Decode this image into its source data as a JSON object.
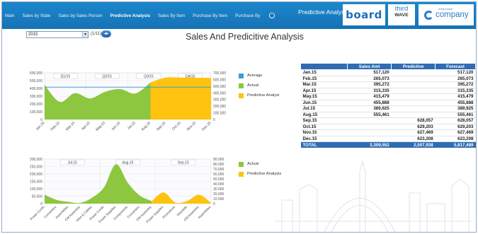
{
  "nav": {
    "items": [
      {
        "label": "Main",
        "active": false
      },
      {
        "label": "Sales by State",
        "active": false
      },
      {
        "label": "Sales by Sales Person",
        "active": false
      },
      {
        "label": "Predictive Analysis",
        "active": true
      },
      {
        "label": "Sales By Item",
        "active": false
      },
      {
        "label": "Purchase By Item",
        "active": false
      },
      {
        "label": "Purchase By",
        "active": false
      }
    ],
    "more_icon": "ⓘ"
  },
  "brand": {
    "section_title": "Predictive Analysis",
    "board_logo": "board",
    "third_wave_line1": "third",
    "third_wave_line2": "WAVE",
    "company_logo": "company",
    "company_prefix": "a third wave"
  },
  "controls": {
    "year": "2015",
    "pager": "(1/11)"
  },
  "page_title": "Sales And Predicitive Analysis",
  "colors": {
    "accent": "#1c87cc",
    "actual": "#8dc63f",
    "predictive": "#ffc20e",
    "average": "#3e9cdc",
    "table_header": "#2f6cb3"
  },
  "chart_data": [
    {
      "type": "area",
      "categories": [
        "Jan.15",
        "Feb.15",
        "Mar.15",
        "Apr.15",
        "May.15",
        "Jun.15",
        "Jul.15",
        "Aug.15",
        "Sep.15",
        "Oct.15",
        "Nov.15",
        "Dec.15"
      ],
      "series": [
        {
          "name": "Average",
          "values": [
            484796,
            484796,
            484796,
            484796,
            484796,
            484796,
            484796,
            484796,
            484796,
            484796,
            484796,
            484796
          ]
        },
        {
          "name": "Actual",
          "values": [
            517120,
            265073,
            395272,
            315335,
            415479,
            455888,
            389925,
            555461,
            null,
            null,
            null,
            null
          ]
        },
        {
          "name": "Predictive Analysi",
          "values": [
            null,
            null,
            null,
            null,
            null,
            null,
            null,
            555461,
            628057,
            629203,
            627469,
            623208
          ]
        }
      ],
      "quarter_labels": [
        "Q1/15",
        "Q2/15",
        "Q3/15",
        "Q4/15"
      ],
      "left_ticks": [
        "600,000",
        "500,000",
        "400,000",
        "300,000",
        "200,000",
        "100,000",
        "0"
      ],
      "right_ticks": [
        "700,000",
        "600,000",
        "500,000",
        "400,000",
        "300,000",
        "200,000",
        "100,000",
        "0"
      ],
      "ylim": [
        0,
        700000
      ],
      "legend_position": "right"
    },
    {
      "type": "area",
      "categories": [
        "Power Cords",
        "Converters",
        "Assemblies",
        "CM Assembly",
        "Wire & Cables",
        "Power Cords",
        "Power Supplies",
        "Components",
        "Converters",
        "CM Assembly",
        "Power Supplies",
        "Promotions",
        "Obsolete",
        "CM Assembly",
        "Assemblies"
      ],
      "series": [
        {
          "name": "Actual",
          "values": [
            60000,
            25000,
            12000,
            5000,
            40000,
            110000,
            265000,
            140000,
            55000,
            18000,
            null,
            null,
            null,
            null,
            null
          ]
        },
        {
          "name": "Predictive Analysis",
          "values": [
            null,
            null,
            null,
            null,
            null,
            null,
            null,
            null,
            null,
            15000,
            75000,
            8000,
            18000,
            60000,
            4000
          ]
        }
      ],
      "period_labels": [
        "Jul.15",
        "Aug.15",
        "Sep.15"
      ],
      "left_ticks": [
        "300,000",
        "250,000",
        "200,000",
        "150,000",
        "100,000",
        "50,000",
        "0"
      ],
      "right_ticks": [
        "90,000",
        "80,000",
        "70,000",
        "60,000",
        "50,000",
        "40,000",
        "30,000",
        "20,000",
        "10,000",
        "0"
      ],
      "ylim": [
        0,
        300000
      ],
      "legend_position": "right"
    }
  ],
  "table": {
    "headers": [
      "",
      "Sales Amt",
      "Predictive",
      "Forecast"
    ],
    "rows": [
      [
        "Jan.15",
        "517,120",
        "",
        "517,120"
      ],
      [
        "Feb.15",
        "265,073",
        "",
        "265,073"
      ],
      [
        "Mar.15",
        "395,272",
        "",
        "395,272"
      ],
      [
        "Apr.15",
        "315,335",
        "",
        "315,335"
      ],
      [
        "May.15",
        "415,479",
        "",
        "415,479"
      ],
      [
        "Jun.15",
        "455,888",
        "",
        "455,888"
      ],
      [
        "Jul.15",
        "389,925",
        "",
        "389,925"
      ],
      [
        "Aug.15",
        "555,461",
        "",
        "555,461"
      ],
      [
        "Sep.15",
        "",
        "628,057",
        "628,057"
      ],
      [
        "Oct.15",
        "",
        "629,203",
        "629,203"
      ],
      [
        "Nov.15",
        "",
        "627,469",
        "627,469"
      ],
      [
        "Dec.15",
        "",
        "623,208",
        "623,208"
      ]
    ],
    "total": [
      "TOTAL",
      "3,309,552",
      "2,507,938",
      "5,817,489"
    ]
  }
}
